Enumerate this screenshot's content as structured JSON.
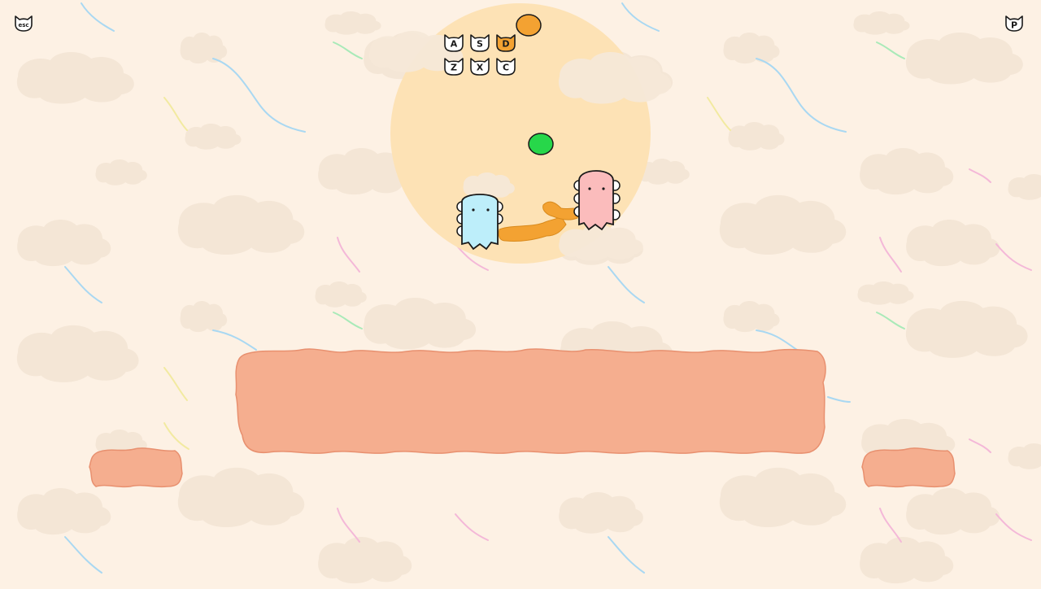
{
  "hud": {
    "esc_button": {
      "label": "esc",
      "icon": "cat-head-icon"
    },
    "pause_button": {
      "label": "P",
      "icon": "cat-head-icon"
    }
  },
  "controls": {
    "keys": [
      {
        "label": "A",
        "active": false
      },
      {
        "label": "S",
        "active": false
      },
      {
        "label": "D",
        "active": true
      },
      {
        "label": "Z",
        "active": false
      },
      {
        "label": "X",
        "active": false
      },
      {
        "label": "C",
        "active": false
      }
    ],
    "active_color": "#f3a232",
    "inactive_color": "#ffffff"
  },
  "colors": {
    "background": "#fdf1e4",
    "cloud": "#f4e6d6",
    "sun": "#fde2b5",
    "platform_fill": "#f5ae8f",
    "platform_stroke": "#e8906f",
    "player_blue": "#bdeefa",
    "player_pink": "#fbbcbc",
    "arm": "#f3a232",
    "ball_green": "#27d74a",
    "ball_orange": "#f3a232"
  }
}
